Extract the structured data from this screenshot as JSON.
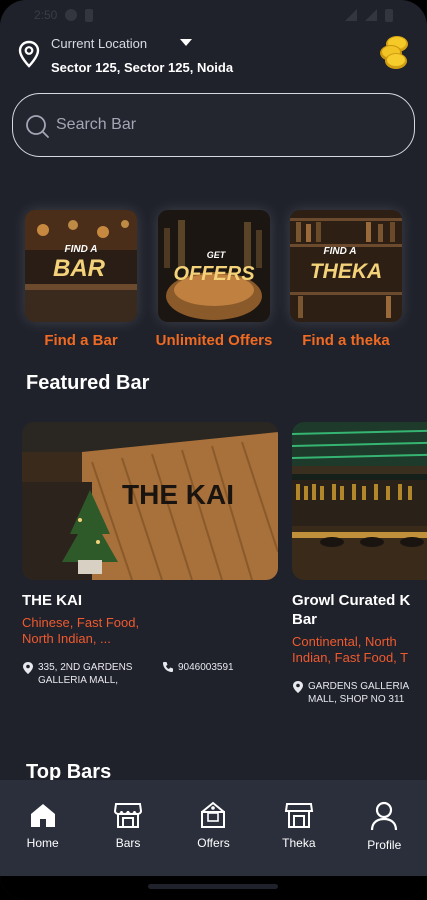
{
  "status_bar": {
    "time": "2:50"
  },
  "location": {
    "label": "Current Location",
    "value": "Sector 125, Sector 125, Noida"
  },
  "search": {
    "placeholder": "Search Bar"
  },
  "categories": [
    {
      "tile_text_1": "FIND A",
      "tile_text_2": "BAR",
      "label": "Find a Bar"
    },
    {
      "tile_text_1": "GET",
      "tile_text_2": "OFFERS",
      "label": "Unlimited Offers"
    },
    {
      "tile_text_1": "FIND A",
      "tile_text_2": "THEKA",
      "label": "Find a theka"
    }
  ],
  "featured": {
    "title": "Featured Bar",
    "bars": [
      {
        "name": "THE KAI",
        "sign": "THE KAI",
        "cuisine": "Chinese, Fast Food, North Indian, ...",
        "address": "335, 2ND GARDENS GALLERIA MALL,",
        "phone": "9046003591"
      },
      {
        "name": "Growl Curated K Bar",
        "cuisine": "Continental, North Indian, Fast Food, T",
        "address": "GARDENS GALLERIA MALL, SHOP NO 311"
      }
    ]
  },
  "top_bars": {
    "title": "Top Bars"
  },
  "nav": [
    {
      "label": "Home",
      "icon": "home-icon"
    },
    {
      "label": "Bars",
      "icon": "bar-shop-icon"
    },
    {
      "label": "Offers",
      "icon": "offers-shop-icon"
    },
    {
      "label": "Theka",
      "icon": "theka-shop-icon"
    },
    {
      "label": "Profile",
      "icon": "profile-icon"
    }
  ],
  "colors": {
    "background": "#1f212b",
    "accent_orange": "#f06a22",
    "cuisine_red": "#ef5a2e",
    "navbar": "#2b2e3b"
  }
}
